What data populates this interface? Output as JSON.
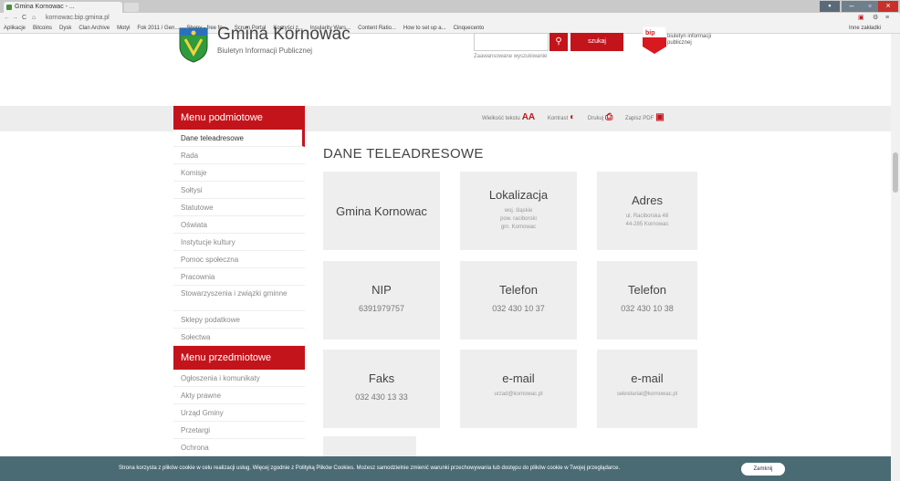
{
  "browser": {
    "tab_title": "Gmina Kornowac - ...",
    "url": "kornowac.bip.gmina.pl",
    "bookmarks": [
      "Aplikacje",
      "Bitcoins",
      "Dysk",
      "Clan Archive",
      "Motyl",
      "Fok 2011 / Gen...",
      "Shopy - free fo...",
      "Scrum Portal",
      "Korzyści z...",
      "Insularity Wars...",
      "Content Ratio...",
      "How to set up a...",
      "Cinquecento"
    ],
    "other_bookmarks": "Inne zakładki"
  },
  "header": {
    "title": "Gmina Kornowac",
    "subtitle": "Biuletyn Informacji Publicznej",
    "search_button": "szukaj",
    "advanced_search": "Zaawansowane wyszukiwanie",
    "bip_label": "biuletyn informacji publicznej"
  },
  "tools": [
    {
      "label": "Wielkość tekstu",
      "icon": "AA"
    },
    {
      "label": "Kontrast",
      "icon": "◐"
    },
    {
      "label": "Drukuj",
      "icon": "⎙"
    },
    {
      "label": "Zapisz PDF",
      "icon": "▣"
    }
  ],
  "sidebar": {
    "menu1_title": "Menu podmiotowe",
    "menu1_items": [
      "Dane teleadresowe",
      "Rada",
      "Komisje",
      "Sołtysi",
      "Statutowe",
      "Oświata",
      "Instytucje kultury",
      "Pomoc społeczna",
      "Pracownia",
      "Stowarzyszenia i związki gminne",
      "Sklepy podatkowe",
      "Sołectwa"
    ],
    "menu2_title": "Menu przedmiotowe",
    "menu2_items": [
      "Ogłoszenia i komunikaty",
      "Akty prawne",
      "Urząd Gminy",
      "Przetargi",
      "Ochrona"
    ]
  },
  "main": {
    "heading": "DANE TELEADRESOWE",
    "cards": [
      {
        "title": "Gmina Kornowac",
        "value": "",
        "sub": []
      },
      {
        "title": "Lokalizacja",
        "value": "",
        "sub": [
          "woj. śląskie",
          "pow. raciborski",
          "gm. Kornowac"
        ]
      },
      {
        "title": "Adres",
        "value": "",
        "sub": [
          "ul. Raciborska 48",
          "44-285 Kornowac"
        ]
      },
      {
        "title": "NIP",
        "value": "6391979757",
        "sub": []
      },
      {
        "title": "Telefon",
        "value": "032 430 10 37",
        "sub": []
      },
      {
        "title": "Telefon",
        "value": "032 430 10 38",
        "sub": []
      },
      {
        "title": "Faks",
        "value": "032 430 13 33",
        "sub": []
      },
      {
        "title": "e-mail",
        "value": "",
        "sub": [
          "urzad@kornowac.pl"
        ]
      },
      {
        "title": "e-mail",
        "value": "",
        "sub": [
          "sekretariat@kornowac.pl"
        ]
      }
    ]
  },
  "cookie": {
    "text": "Strona korzysta z plików cookie w celu realizacji usług. Więcej zgodnie z Polityką Plików Cookies. Możesz samodzielnie zmienić warunki przechowywania lub dostępu do plików cookie w Twojej przeglądarce.",
    "button": "Zamknij"
  },
  "colors": {
    "accent": "#c4141b",
    "cookie_bg": "#4a6b74"
  }
}
